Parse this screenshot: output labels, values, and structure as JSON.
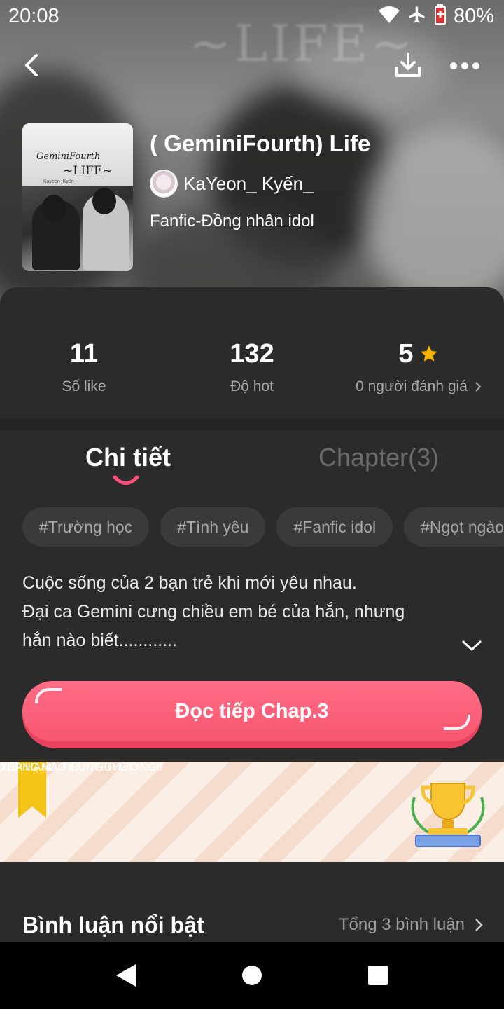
{
  "status_bar": {
    "time": "20:08",
    "battery": "80%"
  },
  "hero": {
    "watermark": "~LIFE~"
  },
  "cover": {
    "title_line1": "GeminiFourth",
    "title_line2": "~LIFE~",
    "subtitle": "Kayeon_Kyến_"
  },
  "book": {
    "title": "( GeminiFourth) Life",
    "author": "KaYeon_ Kyến_",
    "genre": "Fanfic-Đồng nhân idol"
  },
  "stats": {
    "likes": {
      "value": "11",
      "label": "Số like"
    },
    "hot": {
      "value": "132",
      "label": "Độ hot"
    },
    "rating": {
      "value": "5",
      "label": "0 người đánh giá"
    }
  },
  "tabs": {
    "detail": "Chi tiết",
    "chapter": "Chapter(3)"
  },
  "tags": [
    "#Trường học",
    "#Tình yêu",
    "#Fanfic idol",
    "#Ngọt ngào"
  ],
  "description": {
    "line1": "Cuộc sống của 2 bạn trẻ khi mới yêu nhau.",
    "line2": "Đại ca Gemini cưng chiều em bé của hắn, nhưng",
    "line3": "hắn nào biết............"
  },
  "read_button": "Đọc tiếp Chap.3",
  "banner": {
    "line1": "XẾP HẠNG TIỂU THUYẾT",
    "line2": "THÁNG NÀO CŨNG THƯỞNG!!"
  },
  "comments": {
    "title": "Bình luận nổi bật",
    "total": "Tổng 3 bình luận"
  },
  "colors": {
    "accent": "#ff5a76",
    "star": "#f7b500",
    "panel": "#2b2b2b"
  }
}
